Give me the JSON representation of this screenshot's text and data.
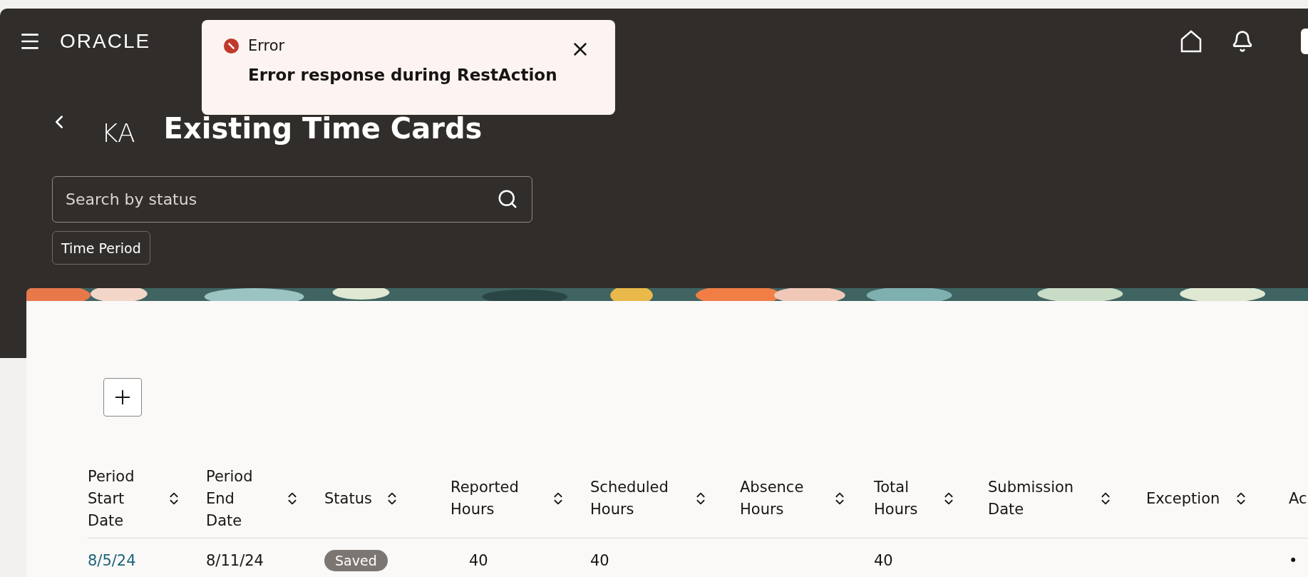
{
  "header": {
    "logo": "ORACLE"
  },
  "toast": {
    "title": "Error",
    "message": "Error response during RestAction"
  },
  "page": {
    "avatar": "KA",
    "title": "Existing Time Cards"
  },
  "search": {
    "placeholder": "Search by status"
  },
  "filters": [
    {
      "label": "Time Period"
    }
  ],
  "table": {
    "columns": [
      {
        "label": "Period Start Date",
        "sortable": true
      },
      {
        "label": "Period End Date",
        "sortable": true
      },
      {
        "label": "Status",
        "sortable": true
      },
      {
        "label": "Reported Hours",
        "sortable": true
      },
      {
        "label": "Scheduled Hours",
        "sortable": true
      },
      {
        "label": "Absence Hours",
        "sortable": true
      },
      {
        "label": "Total Hours",
        "sortable": true
      },
      {
        "label": "Submission Date",
        "sortable": true
      },
      {
        "label": "Exception",
        "sortable": true
      },
      {
        "label": "Ac",
        "sortable": false
      }
    ],
    "rows": [
      {
        "cells": [
          {
            "kind": "link",
            "text": "8/5/24"
          },
          {
            "kind": "text",
            "text": "8/11/24"
          },
          {
            "kind": "badge",
            "text": "Saved"
          },
          {
            "kind": "text",
            "text": "40"
          },
          {
            "kind": "text",
            "text": "40"
          },
          {
            "kind": "empty"
          },
          {
            "kind": "text",
            "text": "40"
          },
          {
            "kind": "empty"
          },
          {
            "kind": "empty"
          },
          {
            "kind": "text",
            "text": "•"
          }
        ]
      }
    ]
  }
}
